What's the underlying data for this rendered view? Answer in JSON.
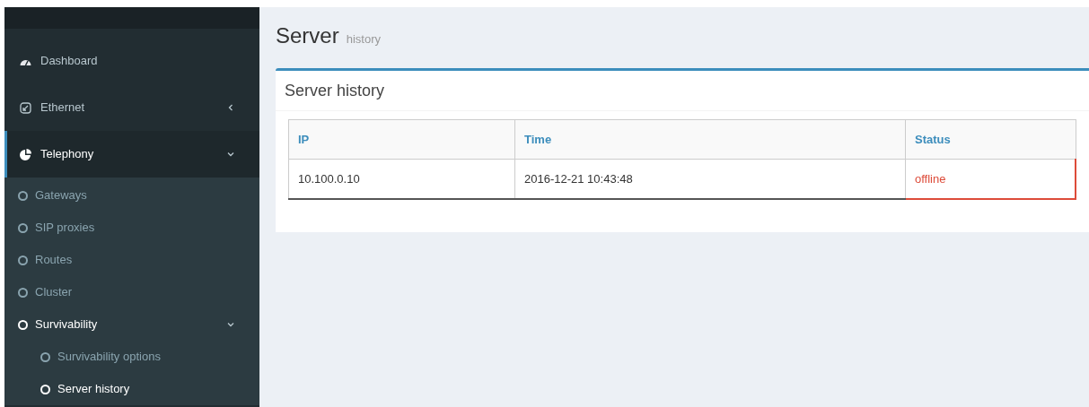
{
  "sidebar": {
    "items": [
      {
        "label": "Dashboard",
        "kind": "dashboard",
        "selected": false
      },
      {
        "label": "Ethernet",
        "kind": "ethernet",
        "selected": false,
        "expanded": false
      },
      {
        "label": "Telephony",
        "kind": "pie",
        "selected": true,
        "expanded": true,
        "children": [
          {
            "label": "Gateways",
            "selected": false
          },
          {
            "label": "SIP proxies",
            "selected": false
          },
          {
            "label": "Routes",
            "selected": false
          },
          {
            "label": "Cluster",
            "selected": false
          },
          {
            "label": "Survivability",
            "selected": true,
            "expanded": true,
            "children": [
              {
                "label": "Survivability options",
                "selected": false
              },
              {
                "label": "Server history",
                "selected": true
              }
            ]
          }
        ]
      }
    ]
  },
  "page": {
    "title": "Server",
    "subtitle": "history"
  },
  "panel": {
    "title": "Server history"
  },
  "table": {
    "columns": [
      "IP",
      "Time",
      "Status"
    ],
    "rows": [
      {
        "cells": [
          "10.100.0.10",
          "2016-12-21 10:43:48",
          "offline"
        ],
        "color": "#dd4b39"
      }
    ]
  }
}
